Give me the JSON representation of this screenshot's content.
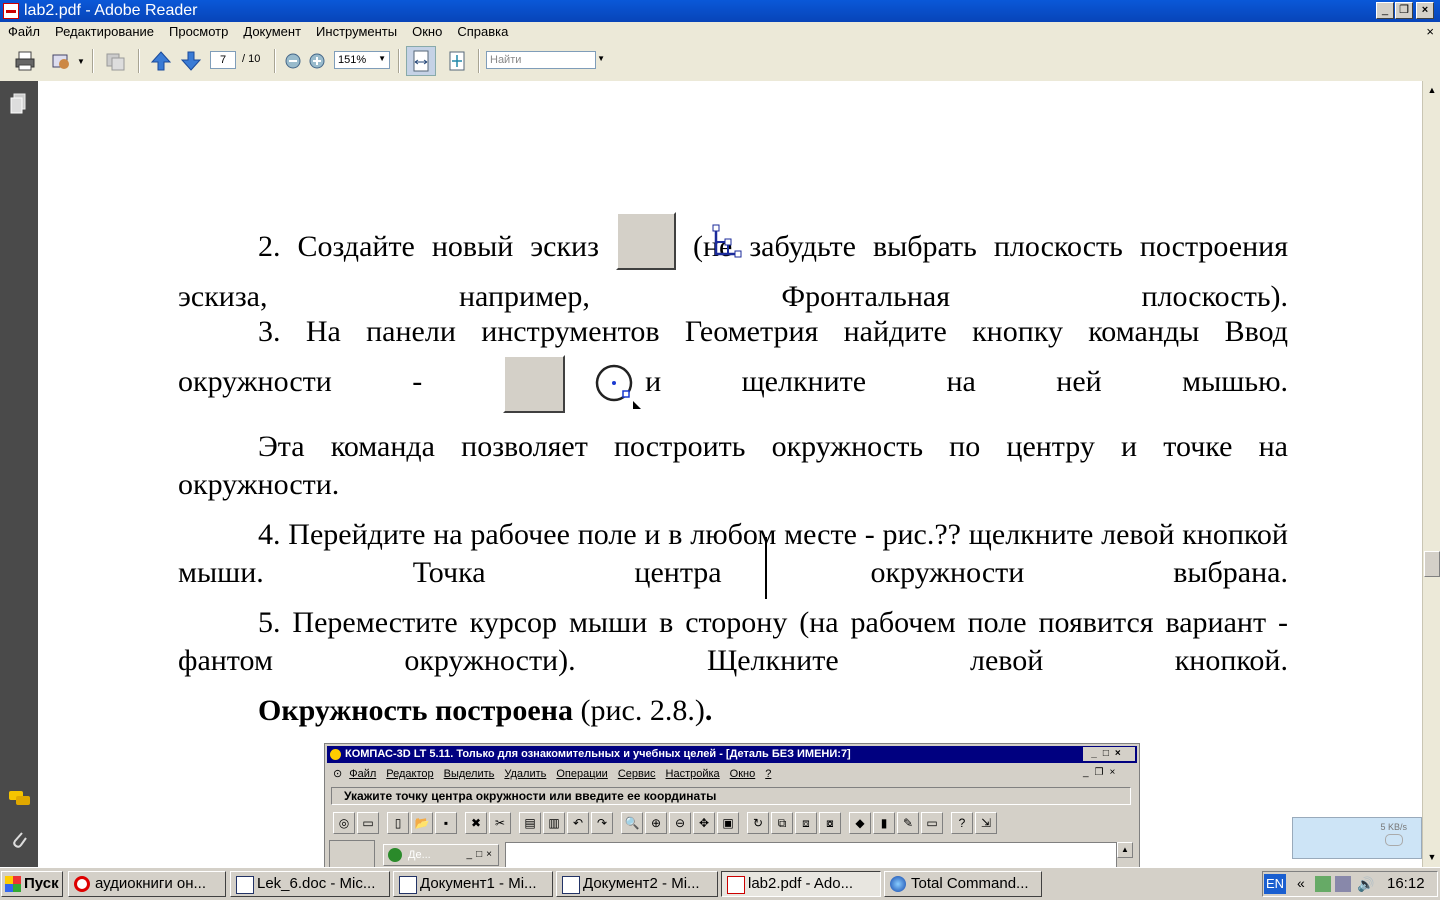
{
  "window": {
    "title": "lab2.pdf - Adobe Reader"
  },
  "menu": {
    "items": [
      "Файл",
      "Редактирование",
      "Просмотр",
      "Документ",
      "Инструменты",
      "Окно",
      "Справка"
    ],
    "close": "×"
  },
  "toolbar": {
    "page_current": "7",
    "page_total": "/ 10",
    "zoom": "151%",
    "search_placeholder": "Найти"
  },
  "document": {
    "para2_a": "2. Создайте новый эскиз",
    "para2_b": "(не забудьте выбрать плоскость построения эскиза, например, Фронтальная плоскость).",
    "para3_a": "3. На панели инструментов Геометрия найдите кнопку команды Ввод окружности -",
    "para3_b": "и щелкните на ней мышью.",
    "para4": "Эта команда позволяет построить окружность по центру и точке на окружности.",
    "para5": "4. Перейдите на рабочее поле и в любом месте - рис.?? щелкните левой кнопкой мыши. Точка центра окружности выбрана.",
    "para6": "5. Переместите курсор мыши в сторону (на рабочем поле появится вариант - фантом окружности). Щелкните левой кнопкой.",
    "para7_bold": "Окружность построена",
    "para7_rest": " (рис. 2.8.)",
    "para7_dot": "."
  },
  "kompas": {
    "title": "КОМПАС-3D LT 5.11. Только для ознакомительных и учебных целей - [Деталь БЕЗ ИМЕНИ:7]",
    "menu": [
      "Файл",
      "Редактор",
      "Выделить",
      "Удалить",
      "Операции",
      "Сервис",
      "Настройка",
      "Окно",
      "?"
    ],
    "status": "Укажите точку центра окружности или введите ее координаты",
    "subwin": "Де..."
  },
  "taskbar": {
    "start": "Пуск",
    "tasks": [
      "аудиокниги он...",
      "Lek_6.doc - Mic...",
      "Документ1 - Mi...",
      "Документ2 - Mi...",
      "lab2.pdf - Ado...",
      "Total Command..."
    ],
    "lang": "EN",
    "chevron": "«",
    "time": "16:12"
  },
  "speed_widget": {
    "label": "5 KB/s"
  },
  "colors": {
    "titlebar": "#0a58d8",
    "leftnav": "#4a4a4a",
    "chrome": "#ece9d8",
    "kompas_title": "#000080"
  }
}
